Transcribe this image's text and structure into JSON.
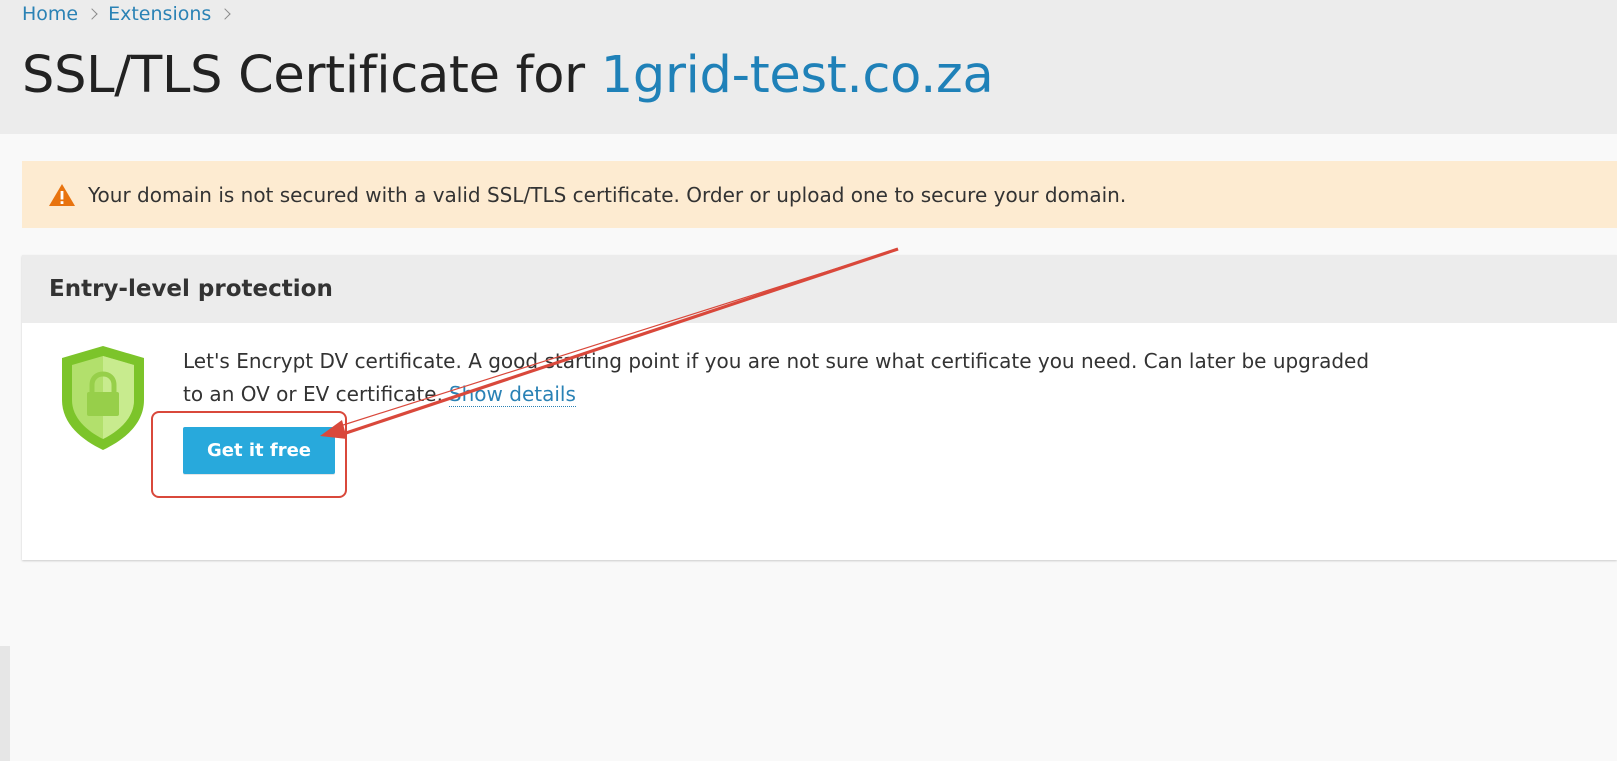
{
  "breadcrumb": {
    "items": [
      "Home",
      "Extensions"
    ]
  },
  "page": {
    "title_prefix": "SSL/TLS Certificate for",
    "domain": "1grid-test.co.za"
  },
  "alert": {
    "icon": "warning-icon",
    "text": "Your domain is not secured with a valid SSL/TLS certificate. Order or upload one to secure your domain."
  },
  "card": {
    "title": "Entry-level protection",
    "icon": "shield-lock-icon",
    "description": "Let's Encrypt DV certificate. A good starting point if you are not sure what certificate you need. Can later be upgraded to an OV or EV certificate.",
    "show_details": "Show details",
    "button_label": "Get it free"
  },
  "colors": {
    "link": "#2a82b5",
    "domain": "#1f81b8",
    "alert_bg": "#fdebd1",
    "warning": "#e8730f",
    "button": "#28a9dc",
    "annotation": "#d9483b",
    "shield": "#7cc42a"
  }
}
